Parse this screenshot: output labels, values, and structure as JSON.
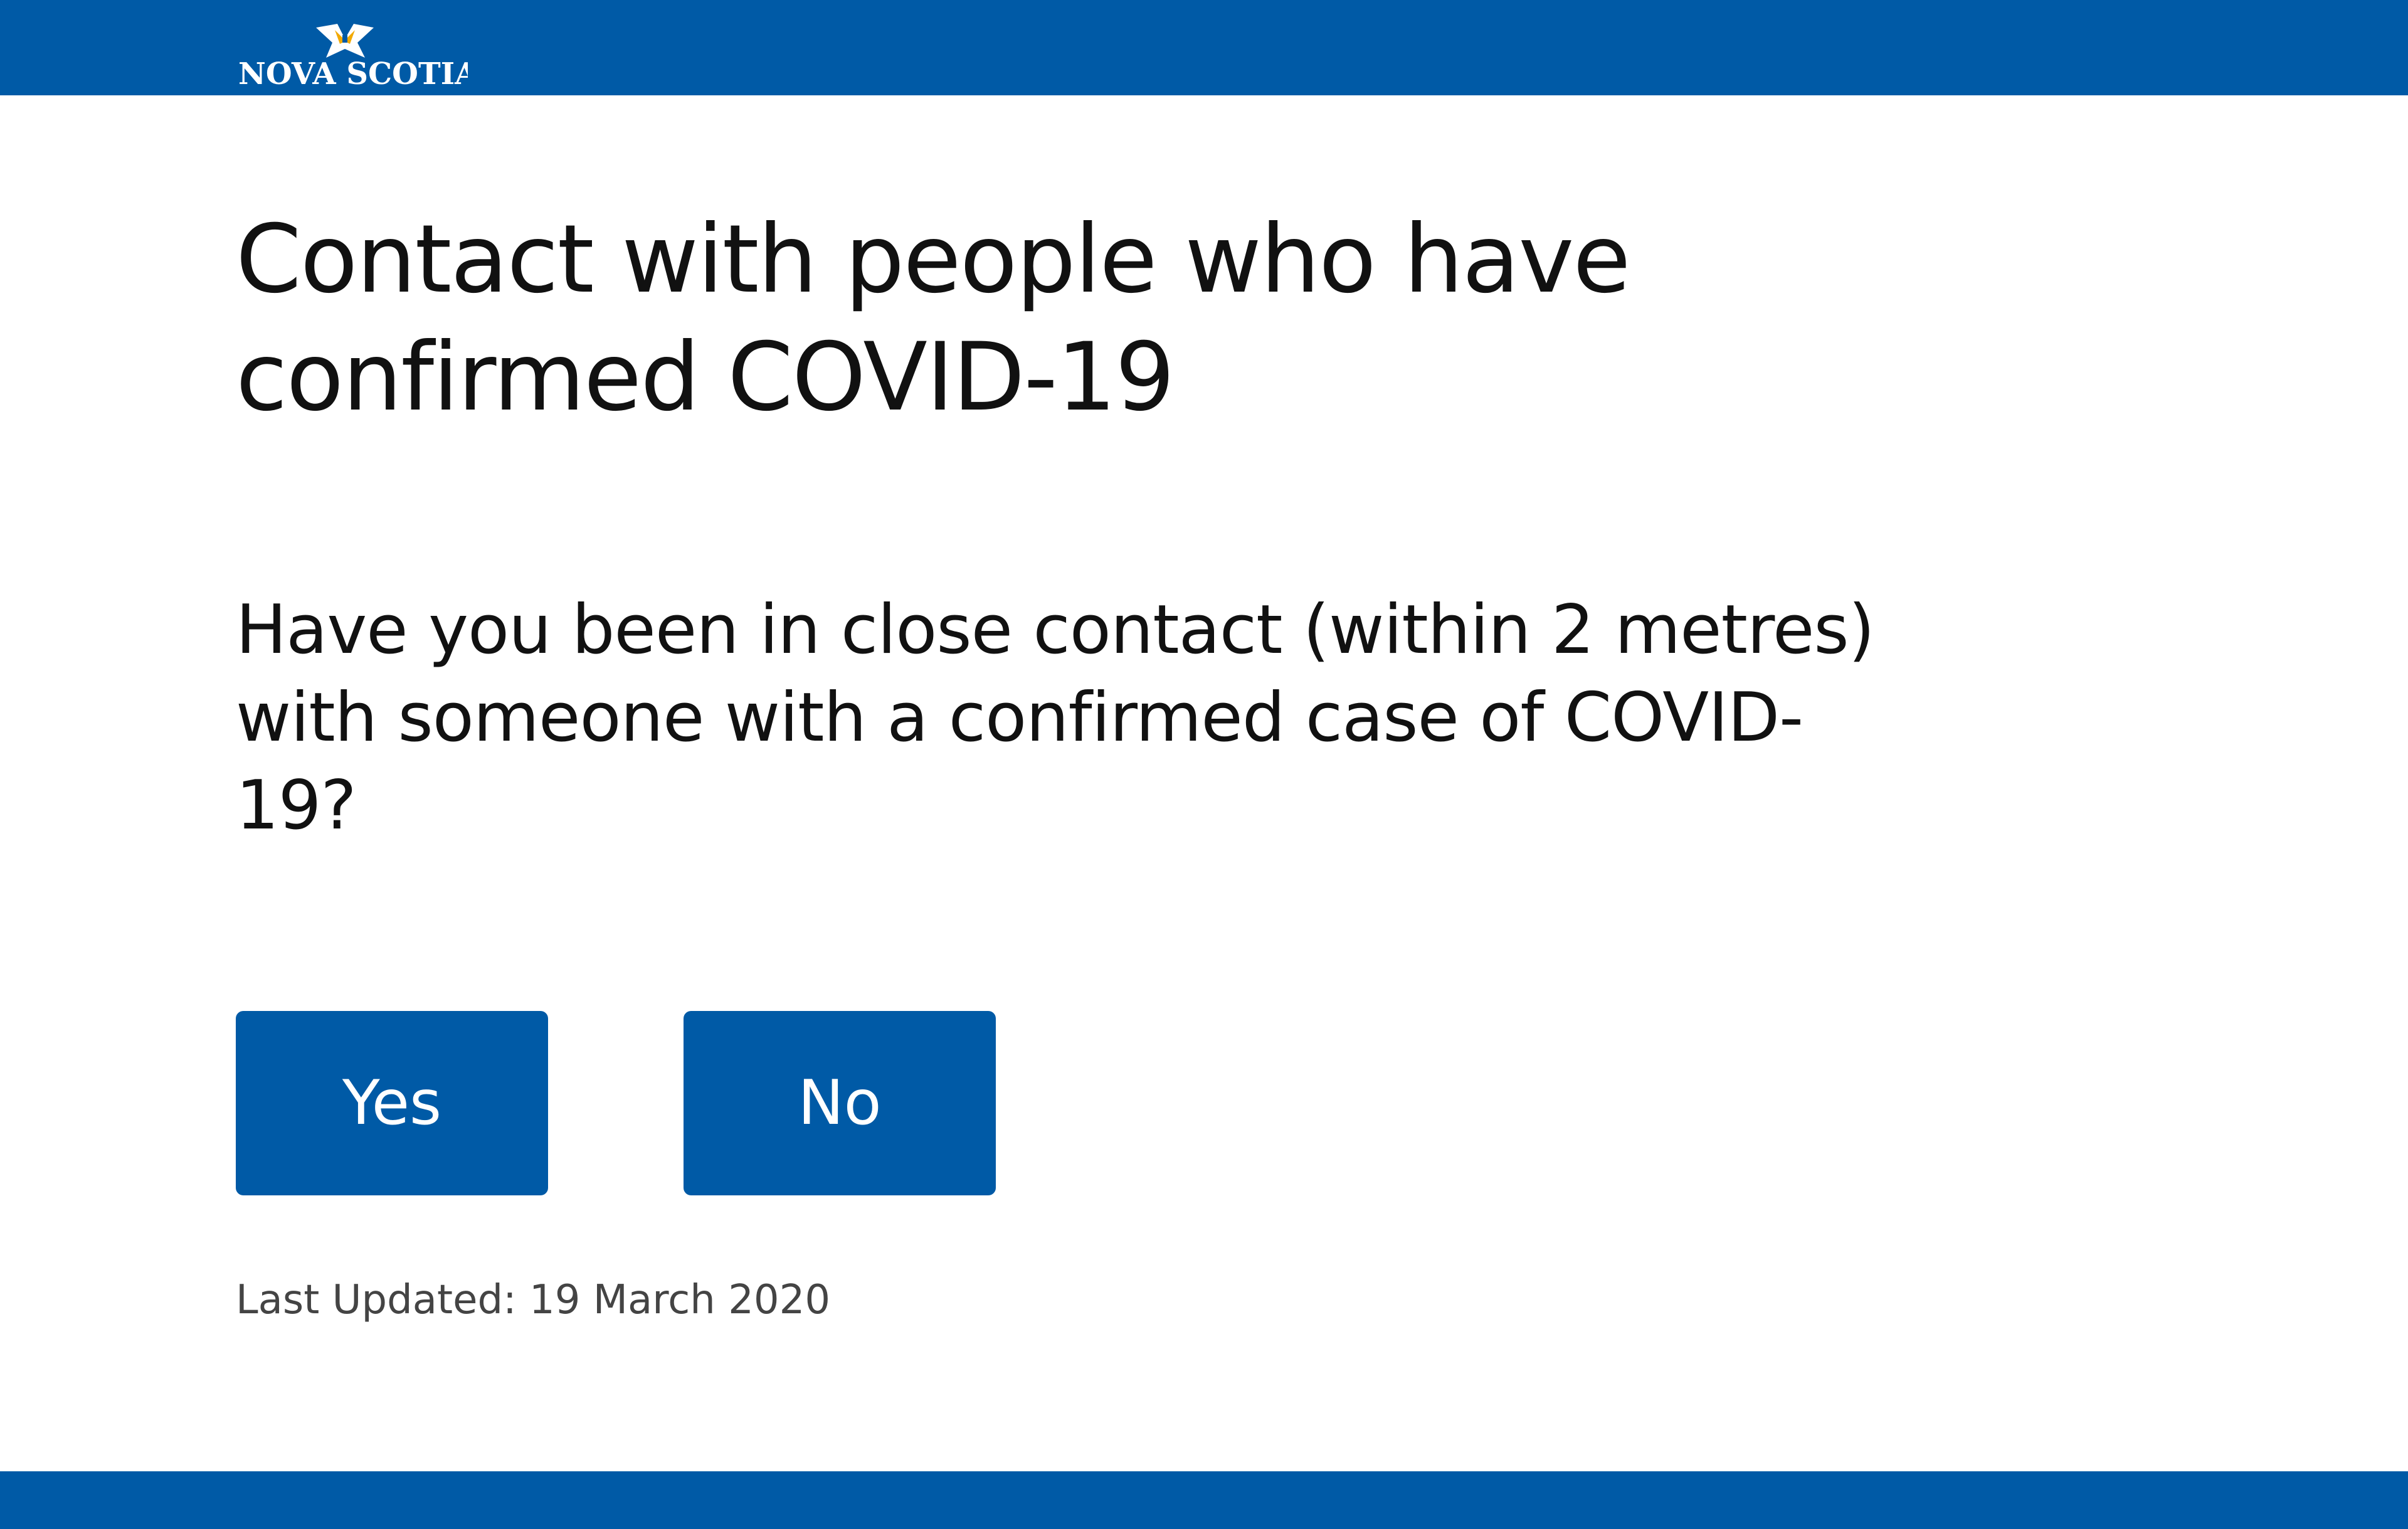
{
  "header": {
    "logo_text": "NOVA SCOTIA",
    "background_color": "#005aa6"
  },
  "main": {
    "title": "Contact with people who have confirmed COVID-19",
    "question": "Have you been in close contact (within 2 metres) with someone with a confirmed case of COVID-19?",
    "yes_label": "Yes",
    "no_label": "No",
    "last_updated": "Last Updated: 19 March 2020"
  },
  "colors": {
    "brand_blue": "#005aa6",
    "text": "#111111",
    "muted_text": "#444444"
  }
}
